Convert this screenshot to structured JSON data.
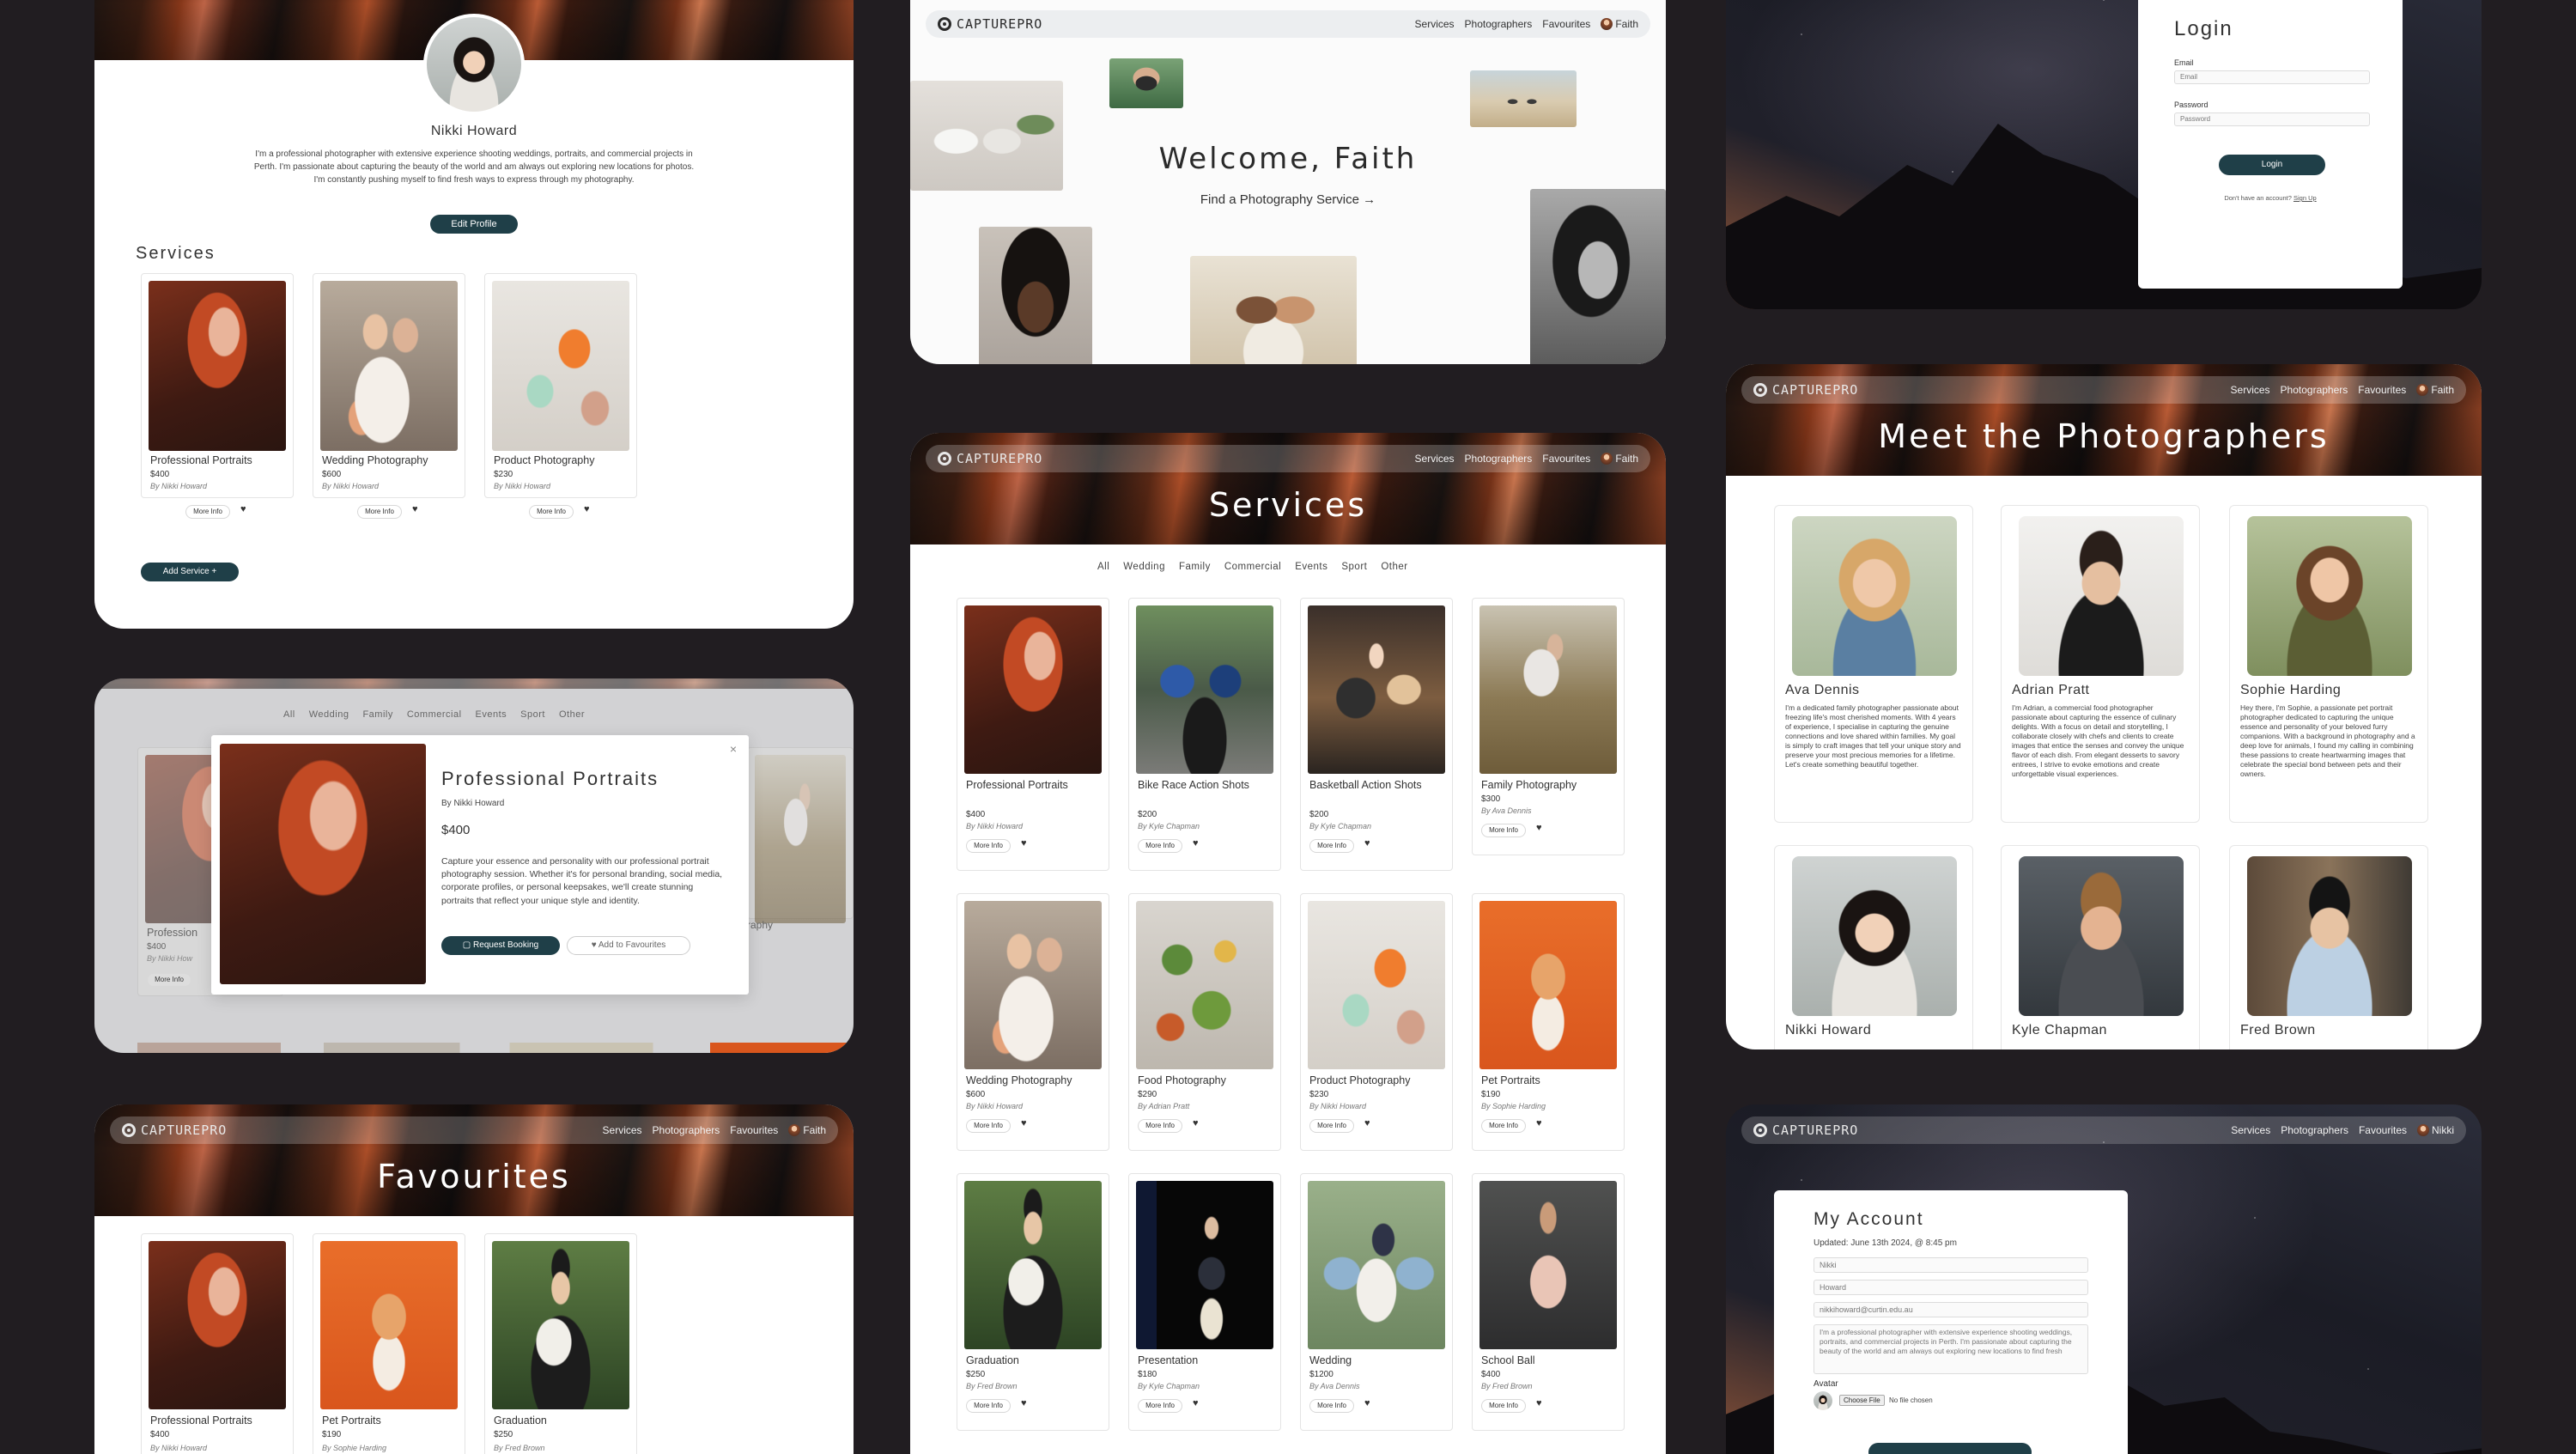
{
  "colors": {
    "accent": "#1f3f48",
    "background": "#211d21",
    "panel": "#ffffff"
  },
  "nav": {
    "brand": "CAPTUREPRO",
    "services": "Services",
    "photographers": "Photographers",
    "favourites": "Favourites",
    "user_faith": "Faith",
    "user_nikki": "Nikki"
  },
  "profile": {
    "name": "Nikki Howard",
    "bio": "I'm a professional photographer with extensive experience shooting weddings, portraits, and commercial projects in Perth. I'm passionate about capturing the beauty of the world and am always out exploring new locations for photos. I'm constantly pushing myself to find fresh ways to express through my photography.",
    "edit_button": "Edit Profile",
    "services_heading": "Services",
    "add_service": "Add Service +",
    "services": [
      {
        "title": "Professional Portraits",
        "price": "$400",
        "by": "By Nikki Howard"
      },
      {
        "title": "Wedding Photography",
        "price": "$600",
        "by": "By Nikki Howard"
      },
      {
        "title": "Product Photography",
        "price": "$230",
        "by": "By Nikki Howard"
      }
    ]
  },
  "more_info": "More Info",
  "welcome": {
    "title": "Welcome, Faith",
    "subtitle": "Find a Photography Service"
  },
  "login": {
    "title": "Login",
    "email_label": "Email",
    "email_placeholder": "Email",
    "password_label": "Password",
    "password_placeholder": "Password",
    "button": "Login",
    "no_account": "Don't have an account?",
    "signup": "Sign Up"
  },
  "filters": [
    "All",
    "Wedding",
    "Family",
    "Commercial",
    "Events",
    "Sport",
    "Other"
  ],
  "modal": {
    "title": "Professional Portraits",
    "by": "By Nikki Howard",
    "price": "$400",
    "description": "Capture your essence and personality with our professional portrait photography session. Whether it's for personal branding, social media, corporate profiles, or personal keepsakes, we'll create stunning portraits that reflect your unique style and identity.",
    "book": "Request Booking",
    "favourite": "Add to Favourites",
    "close": "×",
    "bg_cards": [
      {
        "title": "Profession",
        "price": "$400",
        "by": "By Nikki How"
      },
      {
        "title": "raphy"
      }
    ]
  },
  "services_page": {
    "title": "Services",
    "items": [
      {
        "title": "Professional Portraits",
        "price": "$400",
        "by": "By Nikki Howard"
      },
      {
        "title": "Bike Race Action Shots",
        "price": "$200",
        "by": "By Kyle Chapman"
      },
      {
        "title": "Basketball Action Shots",
        "price": "$200",
        "by": "By Kyle Chapman"
      },
      {
        "title": "Family Photography",
        "price": "$300",
        "by": "By Ava Dennis"
      },
      {
        "title": "Wedding Photography",
        "price": "$600",
        "by": "By Nikki Howard"
      },
      {
        "title": "Food Photography",
        "price": "$290",
        "by": "By Adrian Pratt"
      },
      {
        "title": "Product Photography",
        "price": "$230",
        "by": "By Nikki Howard"
      },
      {
        "title": "Pet Portraits",
        "price": "$190",
        "by": "By Sophie Harding"
      },
      {
        "title": "Graduation",
        "price": "$250",
        "by": "By Fred Brown"
      },
      {
        "title": "Presentation",
        "price": "$180",
        "by": "By Kyle Chapman"
      },
      {
        "title": "Wedding",
        "price": "$1200",
        "by": "By Ava Dennis"
      },
      {
        "title": "School Ball",
        "price": "$400",
        "by": "By Fred Brown"
      }
    ]
  },
  "favourites_page": {
    "title": "Favourites",
    "items": [
      {
        "title": "Professional Portraits",
        "price": "$400",
        "by": "By Nikki Howard"
      },
      {
        "title": "Pet Portraits",
        "price": "$190",
        "by": "By Sophie Harding"
      },
      {
        "title": "Graduation",
        "price": "$250",
        "by": "By Fred Brown"
      }
    ]
  },
  "photographers_page": {
    "title": "Meet the Photographers",
    "people": [
      {
        "name": "Ava Dennis",
        "bio": "I'm a dedicated family photographer passionate about freezing life's most cherished moments. With 4 years of experience, I specialise in capturing the genuine connections and love shared within families. My goal is simply to craft images that tell your unique story and preserve your most precious memories for a lifetime. Let's create something beautiful together."
      },
      {
        "name": "Adrian Pratt",
        "bio": "I'm Adrian, a commercial food photographer passionate about capturing the essence of culinary delights. With a focus on detail and storytelling, I collaborate closely with chefs and clients to create images that entice the senses and convey the unique flavor of each dish. From elegant desserts to savory entrees, I strive to evoke emotions and create unforgettable visual experiences."
      },
      {
        "name": "Sophie Harding",
        "bio": "Hey there, I'm Sophie, a passionate pet portrait photographer dedicated to capturing the unique essence and personality of your beloved furry companions. With a background in photography and a deep love for animals, I found my calling in combining these passions to create heartwarming images that celebrate the special bond between pets and their owners."
      },
      {
        "name": "Nikki Howard",
        "bio": ""
      },
      {
        "name": "Kyle Chapman",
        "bio": ""
      },
      {
        "name": "Fred Brown",
        "bio": ""
      }
    ]
  },
  "account": {
    "title": "My Account",
    "updated": "Updated: June 13th 2024, @ 8:45 pm",
    "first": "Nikki",
    "last": "Howard",
    "email": "nikkihoward@curtin.edu.au",
    "bio": "I'm a professional photographer with extensive experience shooting weddings, portraits, and commercial projects in Perth. I'm passionate about capturing the beauty of the world and am always out exploring new locations to find fresh",
    "avatar_label": "Avatar",
    "choose_file": "Choose File",
    "no_file": "No file chosen"
  }
}
